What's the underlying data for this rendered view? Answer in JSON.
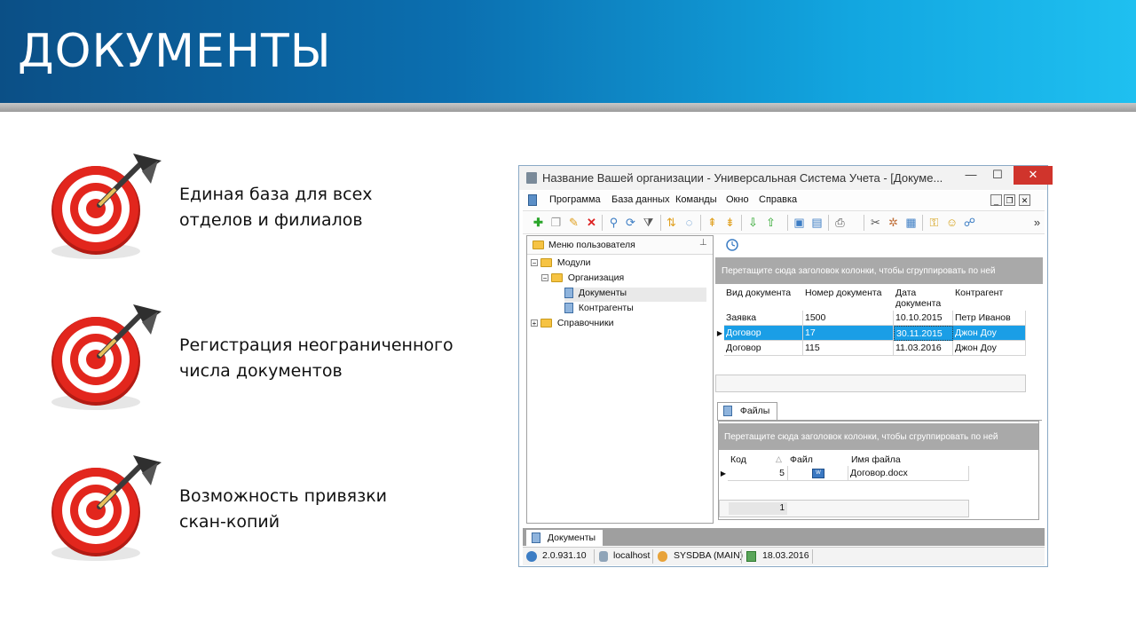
{
  "slide": {
    "title": "ДОКУМЕНТЫ",
    "bullets": [
      {
        "line1": "Единая база для всех",
        "line2": "отделов и филиалов"
      },
      {
        "line1": "Регистрация неограниченного",
        "line2": "числа документов"
      },
      {
        "line1": "Возможность привязки",
        "line2": "скан-копий"
      }
    ],
    "icon": "target-dart-icon"
  },
  "window": {
    "title": "Название Вашей организации - Универсальная Система Учета - [Докуме...",
    "controls": {
      "minimize": "—",
      "maximize": "☐",
      "close": "✕"
    },
    "mdi_controls": {
      "minimize": "_",
      "restore": "❐",
      "close": "✕"
    },
    "menu": [
      "Программа",
      "База данных",
      "Команды",
      "Окно",
      "Справка"
    ],
    "toolbar_overflow": "»",
    "left_panel": {
      "title": "Меню пользователя",
      "pin": "⊥",
      "tree": [
        {
          "label": "Модули",
          "type": "folder",
          "expander": "−"
        },
        {
          "label": "Организация",
          "type": "folder",
          "expander": "−"
        },
        {
          "label": "Документы",
          "type": "doc"
        },
        {
          "label": "Контрагенты",
          "type": "doc"
        },
        {
          "label": "Справочники",
          "type": "folder",
          "expander": "+"
        }
      ]
    },
    "documents_grid": {
      "group_hint": "Перетащите сюда заголовок колонки, чтобы сгруппировать по ней",
      "columns": [
        "Вид документа",
        "Номер документа",
        "Дата документа",
        "Контрагент"
      ],
      "date_col_line1": "Дата",
      "date_col_line2": "документа",
      "rows": [
        [
          "Заявка",
          "1500",
          "10.10.2015",
          "Петр Иванов"
        ],
        [
          "Договор",
          "17",
          "30.11.2015",
          "Джон Доу"
        ],
        [
          "Договор",
          "115",
          "11.03.2016",
          "Джон Доу"
        ]
      ],
      "selected_row": 1
    },
    "files_tab": {
      "tab_label": "Файлы",
      "group_hint": "Перетащите сюда заголовок колонки, чтобы сгруппировать по ней",
      "columns": [
        "Код",
        "Файл",
        "Имя файла"
      ],
      "sort_marker": "△",
      "rows": [
        [
          "5",
          "doc-file-icon",
          "Договор.docx"
        ]
      ],
      "footer_count": "1"
    },
    "bottom_tab": "Документы",
    "status": {
      "version": "2.0.931.10",
      "host": "localhost",
      "user": "SYSDBA (MAIN)",
      "date": "18.03.2016"
    }
  }
}
